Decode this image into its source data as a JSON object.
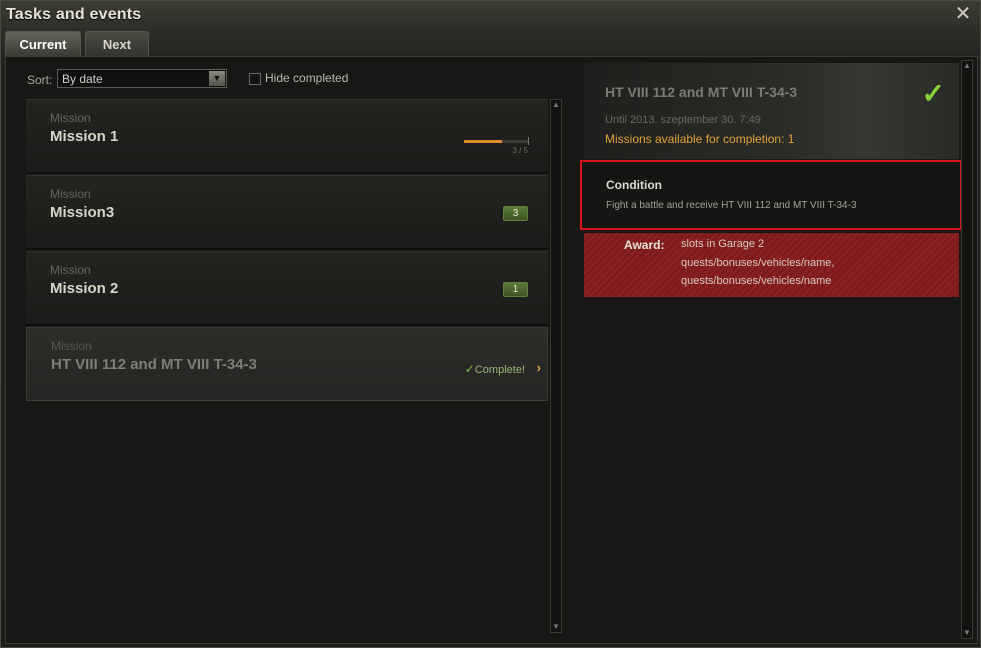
{
  "window": {
    "title": "Tasks and events",
    "close_symbol": "✕"
  },
  "tabs": [
    {
      "label": "Current",
      "active": true
    },
    {
      "label": "Next",
      "active": false
    }
  ],
  "sort": {
    "label": "Sort:",
    "value": "By date"
  },
  "hide_completed": {
    "label": "Hide completed",
    "checked": false
  },
  "missions": [
    {
      "category": "Mission",
      "name": "Mission 1",
      "progress": {
        "current": 3,
        "total": 5,
        "text": "3 / 5"
      }
    },
    {
      "category": "Mission",
      "name": "Mission3",
      "badge": "3"
    },
    {
      "category": "Mission",
      "name": "Mission 2",
      "badge": "1"
    },
    {
      "category": "Mission",
      "name": "HT VIII 112 and MT VIII T-34-3",
      "status": "Complete!",
      "selected": true
    }
  ],
  "detail": {
    "title": "HT VIII 112 and MT VIII T-34-3",
    "until": "Until 2013. szeptember 30. 7:49",
    "available": "Missions available for completion: 1",
    "condition_title": "Condition",
    "condition_text": "Fight a battle and receive HT VIII 112 and MT VIII T-34-3",
    "award_label": "Award:",
    "award_lines": [
      "slots in Garage 2",
      "quests/bonuses/vehicles/name,",
      "quests/bonuses/vehicles/name"
    ]
  },
  "colors": {
    "accent_orange": "#e0a338",
    "complete_green": "#86d13c",
    "highlight_red": "#d8131b",
    "award_red": "#8c2124"
  }
}
